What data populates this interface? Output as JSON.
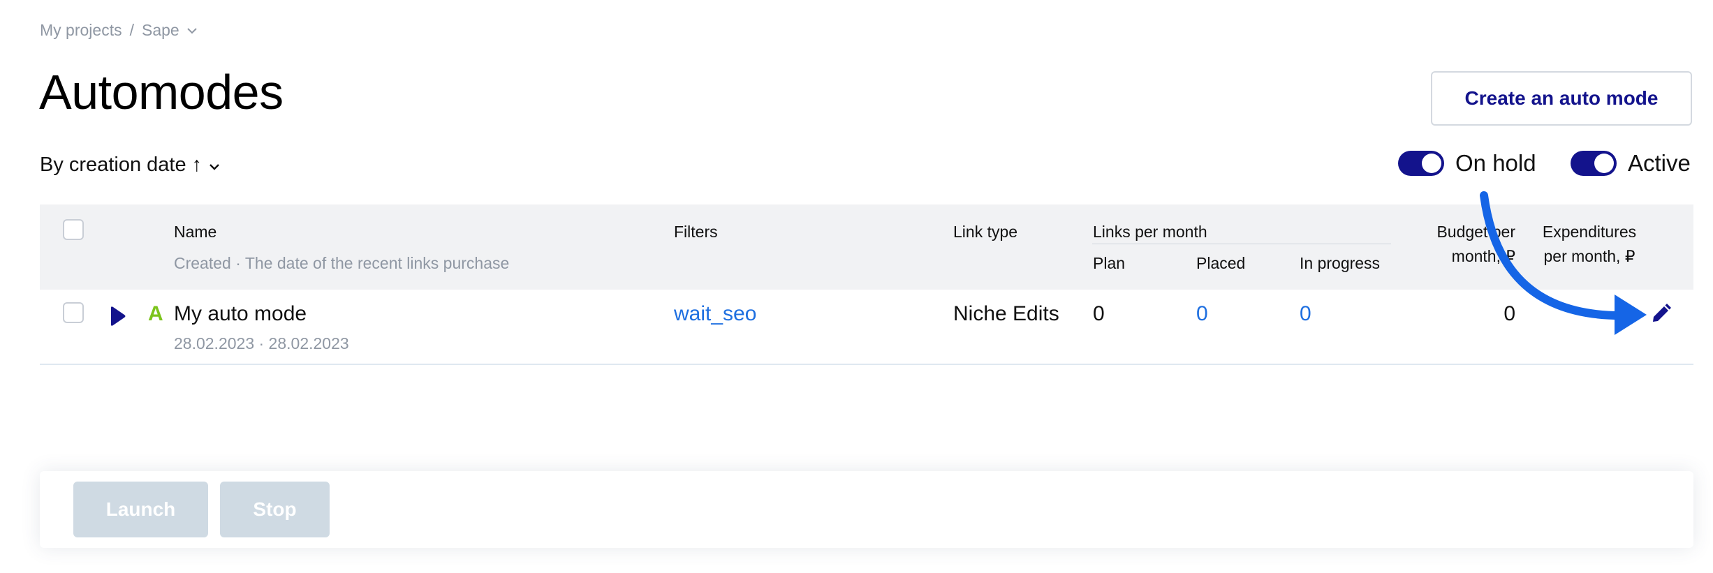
{
  "breadcrumb": {
    "root": "My projects",
    "separator": "/",
    "current": "Sape"
  },
  "page_title": "Automodes",
  "create_button": "Create an auto mode",
  "sort": {
    "label": "By creation date ↑"
  },
  "toggles": {
    "on_hold": "On hold",
    "active": "Active"
  },
  "table": {
    "headers": {
      "name": "Name",
      "name_sub": "Created · The date of the recent links purchase",
      "filters": "Filters",
      "link_type": "Link type",
      "links_per_month": "Links per month",
      "plan": "Plan",
      "placed": "Placed",
      "in_progress": "In progress",
      "budget_line1": "Budget per",
      "budget_line2": "month, ₽",
      "expenditures_line1": "Expenditures",
      "expenditures_line2": "per month, ₽"
    },
    "rows": [
      {
        "grade": "A",
        "name": "My auto mode",
        "dates": "28.02.2023 · 28.02.2023",
        "filter": "wait_seo",
        "link_type": "Niche Edits",
        "plan": "0",
        "placed": "0",
        "in_progress": "0",
        "budget": "0"
      }
    ]
  },
  "actions": {
    "launch": "Launch",
    "stop": "Stop"
  },
  "icons": {
    "sort_chevron": "chevron-down-icon",
    "breadcrumb_chevron": "chevron-down-icon",
    "row_play": "play-icon",
    "row_edit": "pencil-icon",
    "annotation": "curved-arrow-icon"
  },
  "colors": {
    "brand_navy": "#13138c",
    "link_blue": "#1e6fe0",
    "grade_green": "#7cc41c",
    "muted_gray": "#8f97a3",
    "annotation_blue": "#1565e6",
    "disabled_button": "#cfdae3"
  }
}
